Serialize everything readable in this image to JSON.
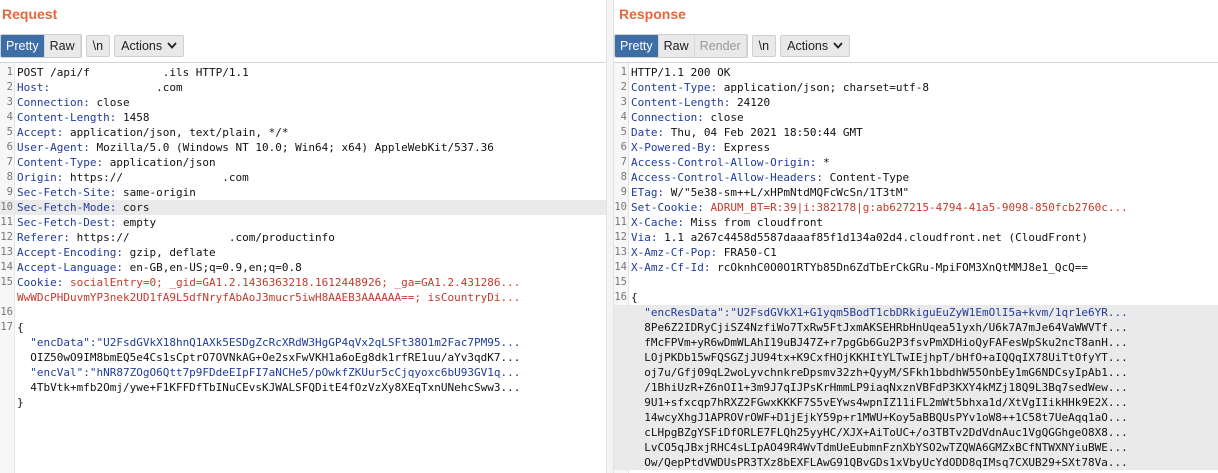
{
  "request": {
    "title": "Request",
    "tabs": [
      {
        "label": "Pretty",
        "active": true
      },
      {
        "label": "Raw",
        "active": false
      }
    ],
    "newline_label": "\\n",
    "actions_label": "Actions",
    "lines": [
      {
        "n": "1",
        "key": "",
        "val": "POST /api/f           .ils HTTP/1.1"
      },
      {
        "n": "2",
        "key": "Host:",
        "val": "                .com"
      },
      {
        "n": "3",
        "key": "Connection:",
        "val": " close"
      },
      {
        "n": "4",
        "key": "Content-Length:",
        "val": " 1458"
      },
      {
        "n": "5",
        "key": "Accept:",
        "val": " application/json, text/plain, */*"
      },
      {
        "n": "6",
        "key": "User-Agent:",
        "val": " Mozilla/5.0 (Windows NT 10.0; Win64; x64) AppleWebKit/537.36"
      },
      {
        "n": "7",
        "key": "Content-Type:",
        "val": " application/json"
      },
      {
        "n": "8",
        "key": "Origin:",
        "val": " https://               .com"
      },
      {
        "n": "9",
        "key": "Sec-Fetch-Site:",
        "val": " same-origin"
      },
      {
        "n": "10",
        "key": "Sec-Fetch-Mode:",
        "val": " cors"
      },
      {
        "n": "11",
        "key": "Sec-Fetch-Dest:",
        "val": " empty"
      },
      {
        "n": "12",
        "key": "Referer:",
        "val": " https://               .com/productinfo"
      },
      {
        "n": "13",
        "key": "Accept-Encoding:",
        "val": " gzip, deflate"
      },
      {
        "n": "14",
        "key": "Accept-Language:",
        "val": " en-GB,en-US;q=0.9,en;q=0.8"
      },
      {
        "n": "15",
        "key": "Cookie:",
        "val": " socialEntry=0; _gid=GA1.2.1436363218.1612448926; _ga=GA1.2.431286..."
      },
      {
        "n": "",
        "key": "",
        "val": "WwWDcPHDuvmYP3nek2UD1fA9L5dfNryfAbAoJ3mucr5iwH8AAEB3AAAAAA==; isCountryDi..."
      },
      {
        "n": "16",
        "key": "",
        "val": ""
      },
      {
        "n": "17",
        "key": "",
        "val": "{"
      },
      {
        "n": "",
        "key": "",
        "val": "  \"encData\":\"U2FsdGVkX18hnQ1AXk5ESDgZcRcXRdW3HgGP4qVx2qLSFt38O1m2Fac7PM95..."
      },
      {
        "n": "",
        "key": "",
        "val": "  OIZ50wO9IM8bmEQ5e4Cs1sCptrO7OVNkAG+Oe2sxFwVKH1a6oEg8dk1rfRE1uu/aYv3qdK7..."
      },
      {
        "n": "",
        "key": "",
        "val": "  \"encVal\":\"hNR87ZOgO6Qtt7p9FDdeEIpFI7aNCHe5/pOwkfZKUur5cCjqyoxc6bU93GV1q..."
      },
      {
        "n": "",
        "key": "",
        "val": "  4TbVtk+mfb2Omj/ywe+F1KFFDfTbINuCEvsKJWALSFQDitE4fOzVzXy8XEqTxnUNehcSww3..."
      },
      {
        "n": "",
        "key": "",
        "val": "}"
      }
    ]
  },
  "response": {
    "title": "Response",
    "tabs": [
      {
        "label": "Pretty",
        "active": true
      },
      {
        "label": "Raw",
        "active": false
      },
      {
        "label": "Render",
        "active": false
      }
    ],
    "newline_label": "\\n",
    "actions_label": "Actions",
    "lines": [
      {
        "n": "1",
        "key": "",
        "val": "HTTP/1.1 200 OK"
      },
      {
        "n": "2",
        "key": "Content-Type:",
        "val": " application/json; charset=utf-8"
      },
      {
        "n": "3",
        "key": "Content-Length:",
        "val": " 24120"
      },
      {
        "n": "4",
        "key": "Connection:",
        "val": " close"
      },
      {
        "n": "5",
        "key": "Date:",
        "val": " Thu, 04 Feb 2021 18:50:44 GMT"
      },
      {
        "n": "6",
        "key": "X-Powered-By:",
        "val": " Express"
      },
      {
        "n": "7",
        "key": "Access-Control-Allow-Origin:",
        "val": " *"
      },
      {
        "n": "8",
        "key": "Access-Control-Allow-Headers:",
        "val": " Content-Type"
      },
      {
        "n": "9",
        "key": "ETag:",
        "val": " W/\"5e38-sm++L/xHPmNtdMQFcWcSn/1T3tM\""
      },
      {
        "n": "10",
        "key": "Set-Cookie:",
        "val": " ADRUM_BT=R:39|i:382178|g:ab627215-4794-41a5-9098-850fcb2760c..."
      },
      {
        "n": "11",
        "key": "X-Cache:",
        "val": " Miss from cloudfront"
      },
      {
        "n": "12",
        "key": "Via:",
        "val": " 1.1 a267c4458d5587daaaf85f1d134a02d4.cloudfront.net (CloudFront)"
      },
      {
        "n": "13",
        "key": "X-Amz-Cf-Pop:",
        "val": " FRA50-C1"
      },
      {
        "n": "14",
        "key": "X-Amz-Cf-Id:",
        "val": " rcOknhC0O0O1RTYb85Dn6ZdTbErCkGRu-MpiFOM3XnQtMMJ8e1_QcQ=="
      },
      {
        "n": "15",
        "key": "",
        "val": ""
      },
      {
        "n": "16",
        "key": "",
        "val": "{"
      },
      {
        "n": "",
        "key": "",
        "val": "  \"encResData\":\"U2FsdGVkX1+G1yqm5BodT1cbDRkiguEuZyW1EmOlI5a+kvm/1qr1e6YR..."
      },
      {
        "n": "",
        "key": "",
        "val": "  8Pe6Z2IDRyCjiSZ4NzfiWo7TxRw5FtJxmAKSEHRbHnUqea51yxh/U6k7A7mJe64VaWWVTf..."
      },
      {
        "n": "",
        "key": "",
        "val": "  fMcFPVm+yR6wDmWLAhI19uBJ47Z+r7pgGb6Gu2P3fsvPmXDHioQyFAFesWpSku2ncT8anH..."
      },
      {
        "n": "",
        "key": "",
        "val": "  LOjPKDb15wFQSGZjJU94tx+K9CxfHOjKKHItYLTwIEjhpT/bHfO+aIQQqIX78UiTtOfyYT..."
      },
      {
        "n": "",
        "key": "",
        "val": "  oj7u/Gfj09qL2woLyvchnkreDpsmv32zh+QyyM/SFkh1bbdhW55OnbEy1mG6NDCsyIpAb1..."
      },
      {
        "n": "",
        "key": "",
        "val": "  /1BhiUzR+Z6nOI1+3m9J7qIJPsKrHmmLP9iaqNxznVBFdP3KXY4kMZj18Q9L3Bq7sedWew..."
      },
      {
        "n": "",
        "key": "",
        "val": "  9U1+sfxcqp7hRXZ2FGwxKKKF7S5vEYws4wpnIZ11iFL2mWt5bhxa1d/XtVgIIikHHk9E2X..."
      },
      {
        "n": "",
        "key": "",
        "val": "  14wcyXhgJ1APROVrOWF+D1jEjkY59p+r1MWU+Koy5aBBQUsPYv1oW8++1C58t7UeAqq1aO..."
      },
      {
        "n": "",
        "key": "",
        "val": "  cLHpgBZgYSFiDfORLE7FLQh25yyHC/XJX+AiToUC+/o3TBTv2DdVdnAuc1VgQGGhgeO8X8..."
      },
      {
        "n": "",
        "key": "",
        "val": "  LvCO5qJBxjRHC4sLIpAO49R4WvTdmUeEubmnFznXbYSO2wTZQWA6GMZxBCfNTWXNYiuBWE..."
      },
      {
        "n": "",
        "key": "",
        "val": "  Ow/QepPtdVWDUsPR3TXz8bEXFLAwG91QBvGDs1xVbyUcYdODD8qIMsq7CXUB29+SXt78Va..."
      }
    ]
  }
}
